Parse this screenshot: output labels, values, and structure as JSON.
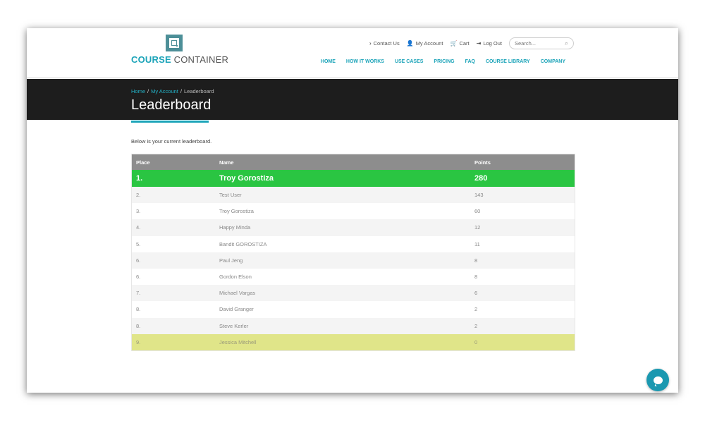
{
  "brand": {
    "name_part1": "COURSE",
    "name_part2": " CONTAINER"
  },
  "toplinks": {
    "contact": "Contact Us",
    "account": "My Account",
    "cart": "Cart",
    "logout": "Log Out",
    "search_placeholder": "Search..."
  },
  "nav": [
    "HOME",
    "HOW IT WORKS",
    "USE CASES",
    "PRICING",
    "FAQ",
    "COURSE LIBRARY",
    "COMPANY"
  ],
  "breadcrumb": {
    "home": "Home",
    "account": "My Account",
    "current": "Leaderboard",
    "separator": "/"
  },
  "page": {
    "title": "Leaderboard",
    "intro": "Below is your current leaderboard."
  },
  "table": {
    "headers": [
      "Place",
      "Name",
      "Points"
    ],
    "rows": [
      {
        "place": "1.",
        "name": "Troy Gorostiza",
        "points": "280"
      },
      {
        "place": "2.",
        "name": "Test User",
        "points": "143"
      },
      {
        "place": "3.",
        "name": "Troy Gorostiza",
        "points": "60"
      },
      {
        "place": "4.",
        "name": "Happy Minda",
        "points": "12"
      },
      {
        "place": "5.",
        "name": "Bandit GOROSTIZA",
        "points": "11"
      },
      {
        "place": "6.",
        "name": "Paul Jeng",
        "points": "8"
      },
      {
        "place": "6.",
        "name": "Gordon Elson",
        "points": "8"
      },
      {
        "place": "7.",
        "name": "Michael Vargas",
        "points": "6"
      },
      {
        "place": "8.",
        "name": "David Granger",
        "points": "2"
      },
      {
        "place": "8.",
        "name": "Steve Kerler",
        "points": "2"
      },
      {
        "place": "9.",
        "name": "Jessica Mitchell",
        "points": "0"
      }
    ]
  },
  "colors": {
    "accent": "#1aa3b8",
    "leader_row": "#2ac542",
    "current_user_row": "#e0e589",
    "header_row": "#8d8d8d",
    "band": "#1d1d1d"
  },
  "icons": {
    "contact": "chevron-right-icon",
    "account": "user-icon",
    "cart": "cart-icon",
    "logout": "logout-icon",
    "search": "search-icon",
    "chat": "chat-bubble-icon"
  }
}
